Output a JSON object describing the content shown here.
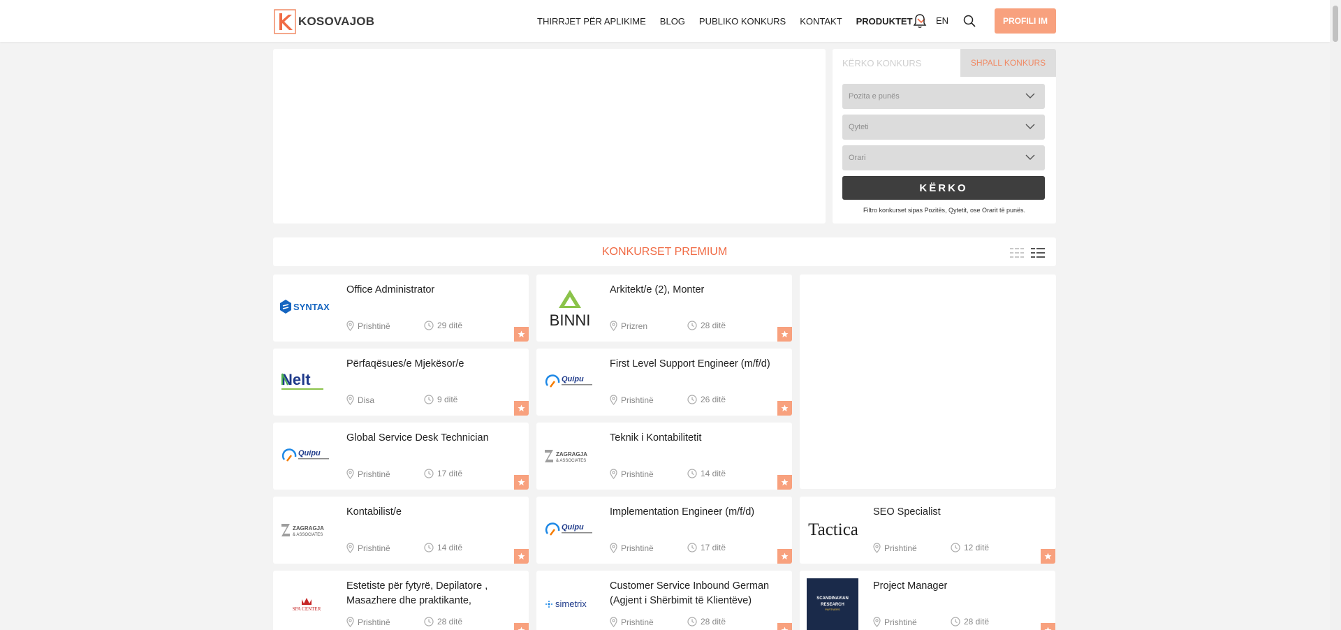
{
  "brand": {
    "name": "KOSOVAJOB",
    "accent": "#f8a17e",
    "accent_text": "#f06b45"
  },
  "nav": {
    "items": [
      "THIRRJET PËR APLIKIME",
      "BLOG",
      "PUBLIKO KONKURS",
      "KONTAKT"
    ],
    "products": "PRODUKTET",
    "lang": "EN",
    "profile": "PROFILI IM"
  },
  "search": {
    "tab_active": "KËRKO KONKURS",
    "tab_other": "SHPALL KONKURS",
    "position_placeholder": "Pozita e punës",
    "city_placeholder": "Qyteti",
    "schedule_placeholder": "Orari",
    "button": "KËRKO",
    "hint": "Filtro konkurset sipas Pozitës, Qytetit, ose Orarit të punës."
  },
  "premium": {
    "title": "KONKURSET PREMIUM"
  },
  "jobs": [
    {
      "title": "Office Administrator",
      "location": "Prishtinë",
      "days": "29 ditë",
      "logo": "syntax-logo",
      "logo_text": "SYNTAX"
    },
    {
      "title": "Arkitekt/e (2), Monter",
      "location": "Prizren",
      "days": "28 ditë",
      "logo": "binni-logo",
      "logo_text": "BINNI"
    },
    {
      "title": "Përfaqësues/e Mjekësor/e",
      "location": "Disa",
      "days": "9 ditë",
      "logo": "nelt-logo",
      "logo_text": "Nelt"
    },
    {
      "title": "First Level Support Engineer (m/f/d)",
      "location": "Prishtinë",
      "days": "26 ditë",
      "logo": "quipu-logo",
      "logo_text": "Quipu"
    },
    {
      "title": "Global Service Desk Technician",
      "location": "Prishtinë",
      "days": "17 ditë",
      "logo": "quipu-logo",
      "logo_text": "Quipu"
    },
    {
      "title": "Teknik i Kontabilitetit",
      "location": "Prishtinë",
      "days": "14 ditë",
      "logo": "zagragja-logo",
      "logo_text": "ZAGRAGJA"
    },
    {
      "title": "Kontabilist/e",
      "location": "Prishtinë",
      "days": "14 ditë",
      "logo": "zagragja-logo",
      "logo_text": "ZAGRAGJA"
    },
    {
      "title": "Implementation Engineer (m/f/d)",
      "location": "Prishtinë",
      "days": "17 ditë",
      "logo": "quipu-logo",
      "logo_text": "Quipu"
    },
    {
      "title": "SEO Specialist",
      "location": "Prishtinë",
      "days": "12 ditë",
      "logo": "tactica-logo",
      "logo_text": "Tactica"
    },
    {
      "title": "Estetiste për fytyrë, Depilatore , Masazhere dhe praktikante,",
      "location": "Prishtinë",
      "days": "28 ditë",
      "logo": "spacenter-logo",
      "logo_text": "SPA CENTER"
    },
    {
      "title": "Customer Service Inbound German (Agjent i Shërbimit të Klientëve)",
      "location": "Prishtinë",
      "days": "28 ditë",
      "logo": "simetrix-logo",
      "logo_text": "simetrix"
    },
    {
      "title": "Project Manager",
      "location": "Prishtinë",
      "days": "28 ditë",
      "logo": "scandinavian-research-logo",
      "logo_text": "SCANDINAVIAN RESEARCH"
    }
  ]
}
